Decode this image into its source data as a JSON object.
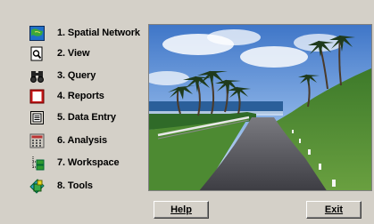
{
  "menu": {
    "items": [
      {
        "label": "1. Spatial Network",
        "icon": "globe-map-icon"
      },
      {
        "label": "2. View",
        "icon": "magnifier-page-icon"
      },
      {
        "label": "3. Query",
        "icon": "binoculars-icon"
      },
      {
        "label": "4. Reports",
        "icon": "red-report-icon"
      },
      {
        "label": "5. Data Entry",
        "icon": "form-entry-icon"
      },
      {
        "label": "6. Analysis",
        "icon": "calculator-icon"
      },
      {
        "label": "7. Workspace",
        "icon": "folder-tree-icon"
      },
      {
        "label": "8. Tools",
        "icon": "tools-icon"
      }
    ]
  },
  "buttons": {
    "help_label": "Help",
    "exit_label": "Exit"
  },
  "colors": {
    "background": "#d4d0c8",
    "sky": "#5a8fd8",
    "sea": "#2a5f9a",
    "grass": "#4f8f2f",
    "road": "#5a5a60"
  }
}
